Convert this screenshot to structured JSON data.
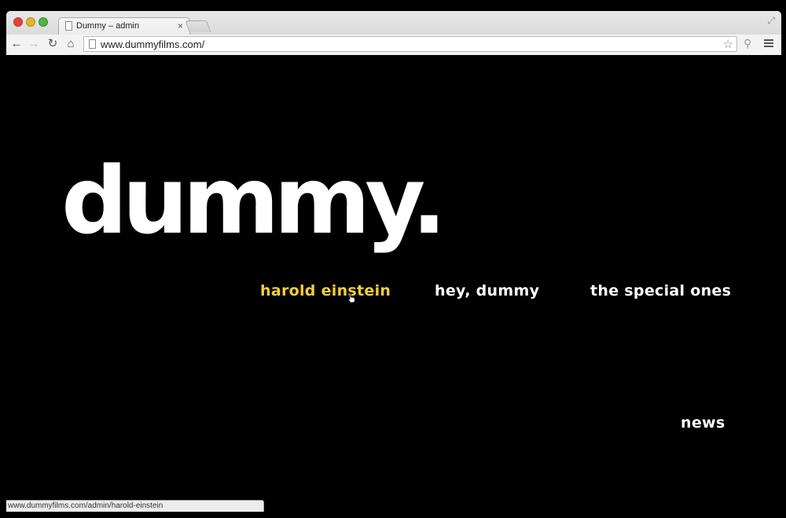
{
  "browser": {
    "tab_title": "Dummy – admin",
    "tab_close": "×",
    "url": "www.dummyfilms.com/",
    "status_url": "www.dummyfilms.com/admin/harold-einstein",
    "icons": {
      "back": "←",
      "forward": "→",
      "reload": "↻",
      "home": "⌂",
      "star": "☆",
      "extension": "⚲",
      "fullscreen": "⤢"
    }
  },
  "site": {
    "logo": "dummy.",
    "nav": [
      {
        "label": "harold einstein",
        "active": true
      },
      {
        "label": "hey, dummy",
        "active": false
      },
      {
        "label": "the special ones",
        "active": false
      },
      {
        "label": "news",
        "active": false
      }
    ],
    "colors": {
      "background": "#000000",
      "text": "#ffffff",
      "hover": "#f2cf3a"
    }
  }
}
